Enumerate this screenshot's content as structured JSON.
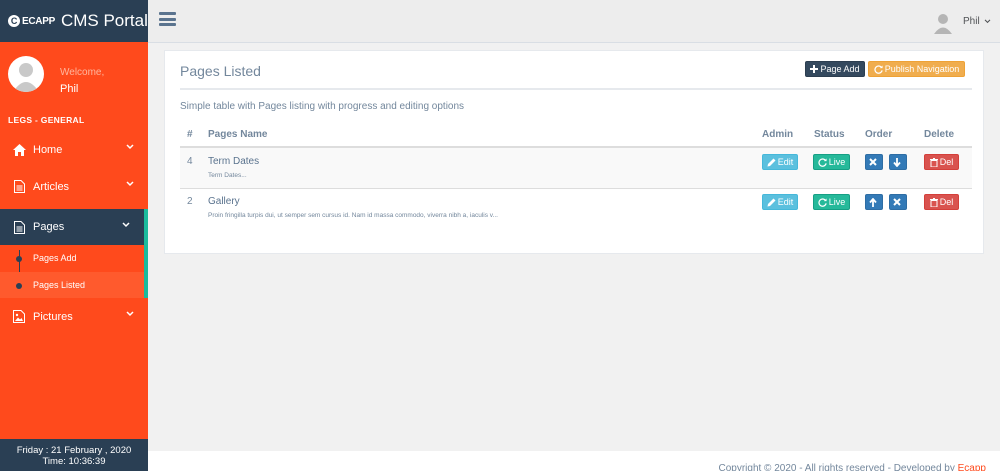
{
  "brand": {
    "logo_text": "ECAPP",
    "title": "CMS Portal"
  },
  "profile": {
    "welcome": "Welcome,",
    "name": "Phil"
  },
  "sidebar": {
    "section_title": "LEGS - GENERAL",
    "items": [
      {
        "label": "Home",
        "icon": "home-icon"
      },
      {
        "label": "Articles",
        "icon": "document-icon"
      },
      {
        "label": "Pages",
        "icon": "document-icon"
      },
      {
        "label": "Pictures",
        "icon": "image-icon"
      }
    ],
    "submenu": [
      "Pages Add",
      "Pages Listed"
    ]
  },
  "clock": {
    "date": "Friday : 21 February , 2020",
    "time": "Time: 10:36:39"
  },
  "topnav": {
    "user": "Phil"
  },
  "panel": {
    "title": "Pages Listed",
    "page_add_label": "Page Add",
    "publish_label": "Publish Navigation",
    "description": "Simple table with Pages listing with progress and editing options"
  },
  "table": {
    "headers": [
      "#",
      "Pages Name",
      "Admin",
      "Status",
      "Order",
      "Delete"
    ],
    "rows": [
      {
        "num": "4",
        "name": "Term Dates",
        "desc": "Term Dates...",
        "edit": "Edit",
        "status": "Live",
        "del": "Del"
      },
      {
        "num": "2",
        "name": "Gallery",
        "desc": "Proin fringilla turpis dui, ut semper sem cursus id. Nam id massa commodo, viverra nibh a, iaculis v...",
        "edit": "Edit",
        "status": "Live",
        "del": "Del"
      }
    ]
  },
  "footer": {
    "text": "Copyright © 2020 - All rights reserved - Developed by",
    "brand": "Ecapp"
  },
  "colors": {
    "sidebar": "#ff4a1c",
    "dark": "#2a3f54",
    "accent": "#1abb9c"
  }
}
